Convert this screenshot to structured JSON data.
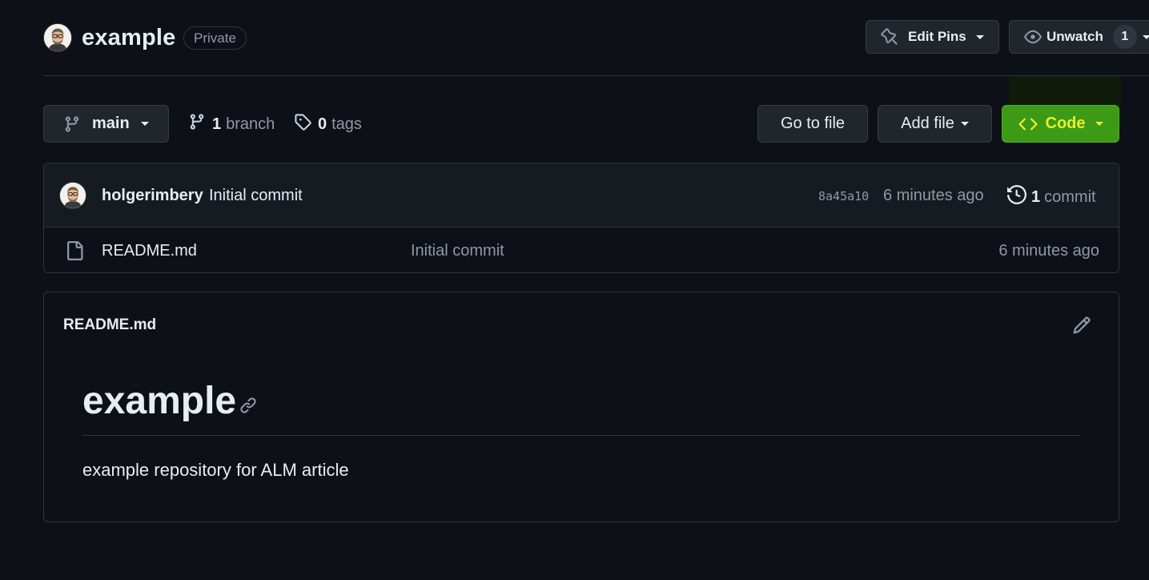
{
  "repo": {
    "name": "example",
    "visibility": "Private"
  },
  "header_actions": {
    "edit_pins_label": "Edit Pins",
    "unwatch_label": "Unwatch",
    "watch_count": "1"
  },
  "file_nav": {
    "branch_name": "main",
    "branch_count": "1",
    "branch_label": "branch",
    "tag_count": "0",
    "tag_label": "tags",
    "go_to_file_label": "Go to file",
    "add_file_label": "Add file",
    "code_label": "Code"
  },
  "latest_commit": {
    "author": "holgerimbery",
    "message": "Initial commit",
    "sha": "8a45a10",
    "time": "6 minutes ago",
    "commit_count": "1",
    "commit_label": "commit"
  },
  "files": [
    {
      "name": "README.md",
      "commit_message": "Initial commit",
      "time": "6 minutes ago"
    }
  ],
  "readme": {
    "filename": "README.md",
    "heading": "example",
    "paragraph": "example repository for ALM article"
  },
  "colors": {
    "background": "#0d1117",
    "code_button": "#3c9a16",
    "code_text": "#e9f02a"
  },
  "icons": [
    "avatar",
    "pin-icon",
    "eye-icon",
    "git-branch-icon",
    "tag-icon",
    "code-icon",
    "history-icon",
    "file-icon",
    "pencil-icon",
    "link-icon"
  ]
}
